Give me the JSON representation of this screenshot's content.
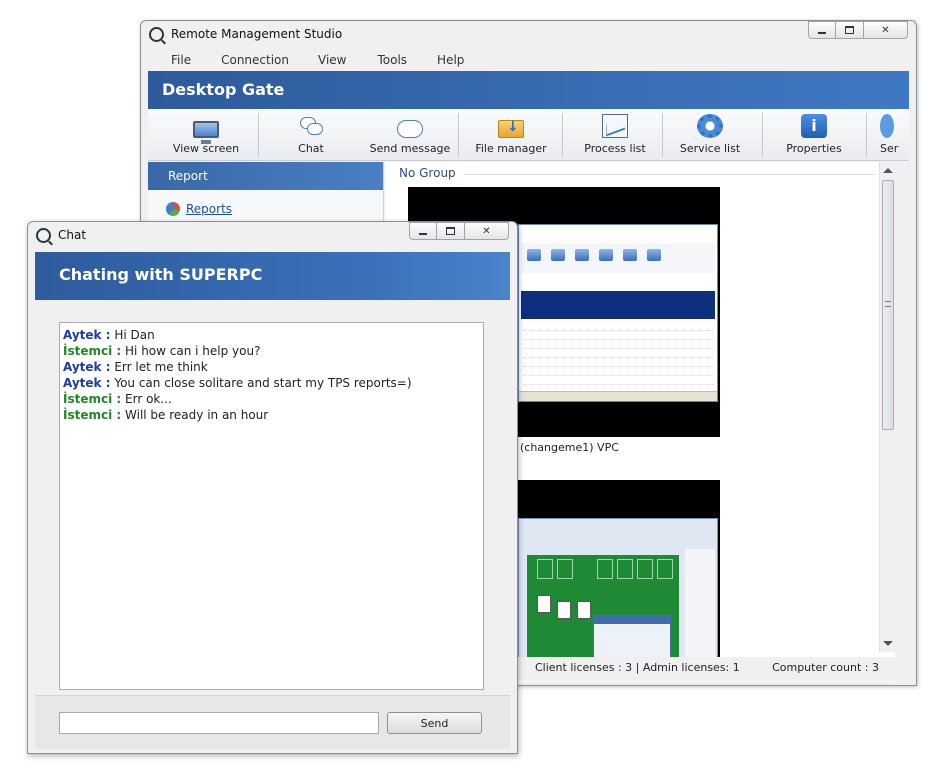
{
  "main_window": {
    "title": "Remote Management Studio",
    "menu": [
      "File",
      "Connection",
      "View",
      "Tools",
      "Help"
    ],
    "banner_title": "Desktop Gate",
    "toolbar": [
      {
        "label": "View screen",
        "icon": "monitor-icon"
      },
      {
        "label": "Chat",
        "icon": "chat-icon"
      },
      {
        "label": "Send message",
        "icon": "message-icon"
      },
      {
        "label": "File manager",
        "icon": "folder-icon"
      },
      {
        "label": "Process list",
        "icon": "process-icon"
      },
      {
        "label": "Service list",
        "icon": "gear-icon"
      },
      {
        "label": "Properties",
        "icon": "info-icon"
      },
      {
        "label": "Ser",
        "icon": "partial-icon"
      }
    ],
    "left_panel": {
      "header": "Report",
      "link": "Reports"
    },
    "content": {
      "group_label": "No Group",
      "computers": [
        {
          "caption": "(changeme1) VPC"
        }
      ]
    },
    "status": {
      "licenses": "Client licenses : 3 | Admin licenses: 1",
      "count": "Computer count : 3"
    }
  },
  "chat_window": {
    "title": "Chat",
    "banner_title": "Chating with SUPERPC",
    "messages": [
      {
        "sender": "Aytek :",
        "text": " Hi Dan",
        "color": "#1b3ca6"
      },
      {
        "sender": "İstemci :",
        "text": " Hi how can i help you?",
        "color": "#1f8a22"
      },
      {
        "sender": "Aytek :",
        "text": " Err let me think",
        "color": "#1b3ca6"
      },
      {
        "sender": "Aytek :",
        "text": " You can close solitare and start my TPS reports=)",
        "color": "#1b3ca6"
      },
      {
        "sender": "İstemci :",
        "text": " Err ok...",
        "color": "#1f8a22"
      },
      {
        "sender": "İstemci :",
        "text": " Will be ready in an hour",
        "color": "#1f8a22"
      }
    ],
    "input_value": "",
    "send_label": "Send"
  },
  "colors": {
    "banner": "#3a6db3",
    "sender_blue": "#1b3ca6",
    "sender_green": "#1f8a22"
  }
}
